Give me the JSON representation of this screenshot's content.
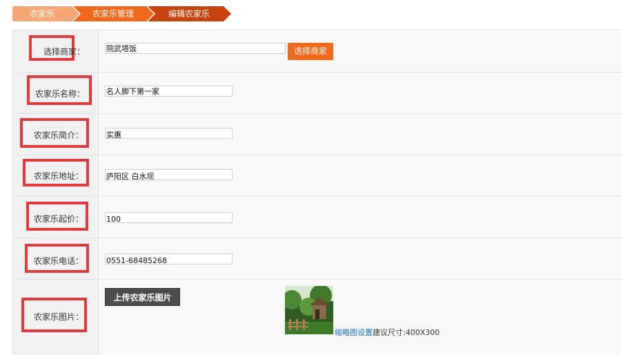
{
  "breadcrumb": [
    "农家乐",
    "农家乐管理",
    "编辑农家乐"
  ],
  "form": {
    "merchant": {
      "label": "选择商家：",
      "value": "院武塔饭",
      "button": "选择商家"
    },
    "name": {
      "label": "农家乐名称：",
      "value": "名人脚下第一家"
    },
    "intro": {
      "label": "农家乐简介：",
      "value": "实惠"
    },
    "address": {
      "label": "农家乐地址：",
      "value": "庐阳区 白水坝"
    },
    "price": {
      "label": "农家乐起价：",
      "value": "100"
    },
    "phone": {
      "label": "农家乐电话：",
      "value": "0551-68485268"
    },
    "image": {
      "label": "农家乐图片：",
      "upload_button": "上传农家乐图片",
      "thumb_link": "缩略图设置",
      "hint": "建议尺寸:400X300"
    }
  },
  "colors": {
    "crumb_1": "#f7a675",
    "crumb_2": "#f2681c",
    "crumb_3": "#c8440f",
    "highlight_border": "#e23a3a",
    "select_button": "#f26a19",
    "upload_button": "#4d4d4d"
  },
  "icons": {
    "thumbnail": "garden-photo"
  }
}
